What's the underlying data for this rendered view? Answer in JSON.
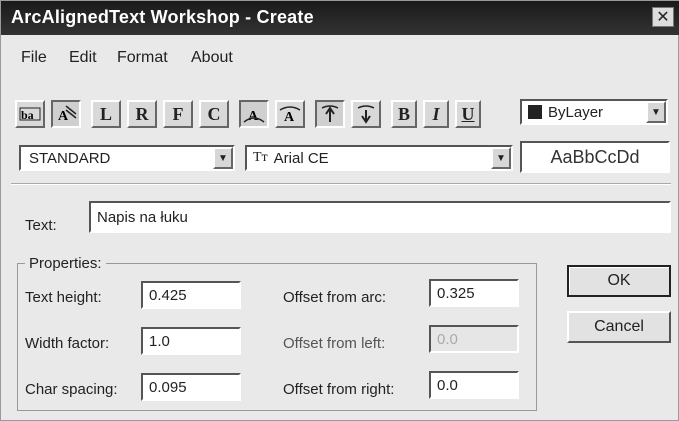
{
  "window": {
    "title": "ArcAlignedText Workshop - Create",
    "close_glyph": "✕"
  },
  "menu": [
    {
      "label": "File"
    },
    {
      "label": "Edit"
    },
    {
      "label": "Format"
    },
    {
      "label": "About"
    }
  ],
  "toolbar": {
    "btn_L": "L",
    "btn_R": "R",
    "btn_F": "F",
    "btn_C": "C",
    "btn_B": "B",
    "btn_I": "I",
    "btn_U": "U",
    "layer": "ByLayer"
  },
  "style_select": {
    "value": "STANDARD"
  },
  "font_select": {
    "value": "Arial CE",
    "icon": "truetype-icon"
  },
  "preview": {
    "text": "AaBbCcDd"
  },
  "text": {
    "label": "Text:",
    "value": "Napis na łuku"
  },
  "properties": {
    "title": "Properties:",
    "text_height": {
      "label": "Text height:",
      "value": "0.425"
    },
    "width_factor": {
      "label": "Width factor:",
      "value": "1.0"
    },
    "char_spacing": {
      "label": "Char spacing:",
      "value": "0.095"
    },
    "offset_arc": {
      "label": "Offset from arc:",
      "value": "0.325"
    },
    "offset_left": {
      "label": "Offset from left:",
      "value": "0.0"
    },
    "offset_right": {
      "label": "Offset from right:",
      "value": "0.0"
    }
  },
  "buttons": {
    "ok": "OK",
    "cancel": "Cancel"
  }
}
